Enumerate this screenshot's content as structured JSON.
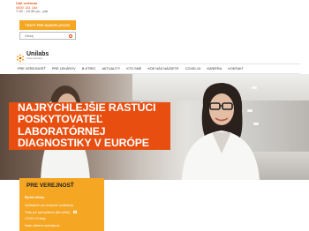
{
  "callcentrum": {
    "title": "Call centrum",
    "phone": "0800 151 184",
    "hours": "7.00 - 15.30 po - pia"
  },
  "sampling_button": {
    "label": "TESTY PRE SAMOPLATCOV"
  },
  "search": {
    "placeholder": "Hľadaj"
  },
  "logo": {
    "name": "Unilabs",
    "sub": "Swiss Laboratory"
  },
  "nav": {
    "items": [
      {
        "label": "PRE VEREJNOSŤ"
      },
      {
        "label": "PRE LEKÁROV"
      },
      {
        "label": "B-KTRIO"
      },
      {
        "label": "AKTUALITY"
      },
      {
        "label": "KTO SME"
      },
      {
        "label": "KDE NÁS NÁJDETE"
      },
      {
        "label": "COVID-19"
      },
      {
        "label": "KARIÉRA"
      },
      {
        "label": "KONTAKT"
      }
    ]
  },
  "hero": {
    "headline": [
      "NAJRÝCHLEJŠIE RASTÚCI",
      "POSKYTOVATEĽ",
      "LABORATÓRNEJ",
      "DIAGNOSTIKY V EURÓPE"
    ]
  },
  "panel": {
    "title": "PRE VEREJNOSŤ",
    "subtitle": "Rýchle odkazy",
    "links": [
      "Vyhľadanie pre verejnosť (ordinácia)",
      "Testy pre samoplatcov (lab online)",
      "COVID-19 testy",
      "Naše odberné ambulancie"
    ]
  },
  "colors": {
    "brand_orange": "#e84e0f",
    "accent_yellow": "#f5a623"
  }
}
